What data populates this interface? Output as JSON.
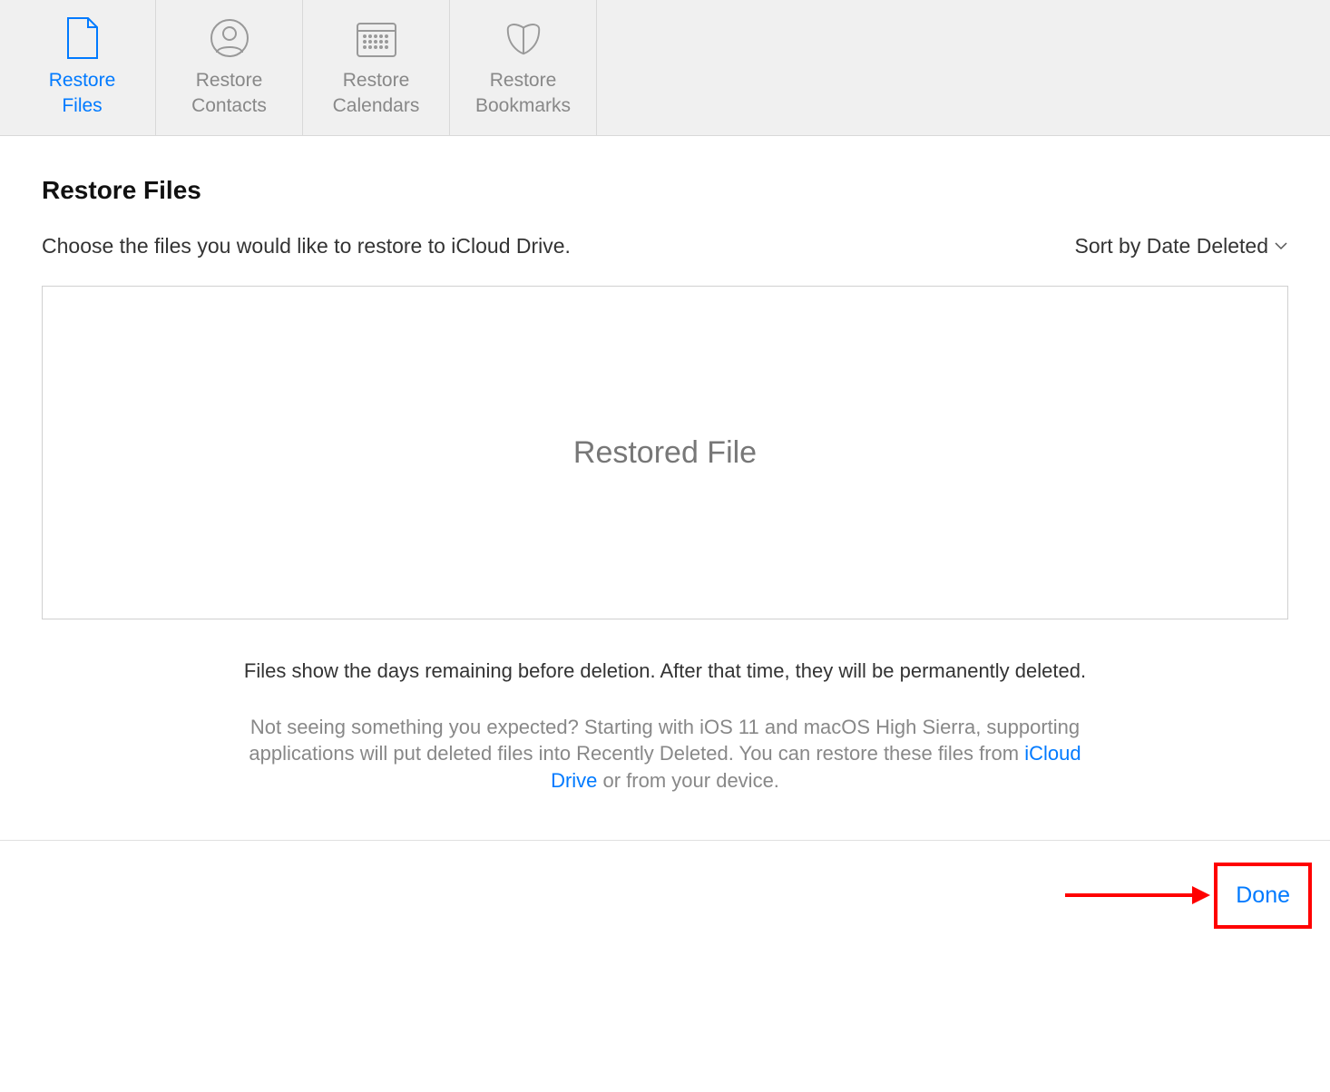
{
  "tabs": [
    {
      "label": "Restore\nFiles",
      "icon": "file",
      "active": true
    },
    {
      "label": "Restore\nContacts",
      "icon": "contact",
      "active": false
    },
    {
      "label": "Restore\nCalendars",
      "icon": "calendar",
      "active": false
    },
    {
      "label": "Restore\nBookmarks",
      "icon": "bookmark",
      "active": false
    }
  ],
  "page_title": "Restore Files",
  "instruction": "Choose the files you would like to restore to iCloud Drive.",
  "sort_label": "Sort by Date Deleted",
  "box_text": "Restored File",
  "info_text": "Files show the days remaining before deletion. After that time, they will be permanently deleted.",
  "help_text_before": "Not seeing something you expected? Starting with iOS 11 and macOS High Sierra, supporting applications will put deleted files into Recently Deleted. You can restore these files from ",
  "help_link_text": "iCloud Drive",
  "help_text_after": " or from your device.",
  "done_label": "Done"
}
